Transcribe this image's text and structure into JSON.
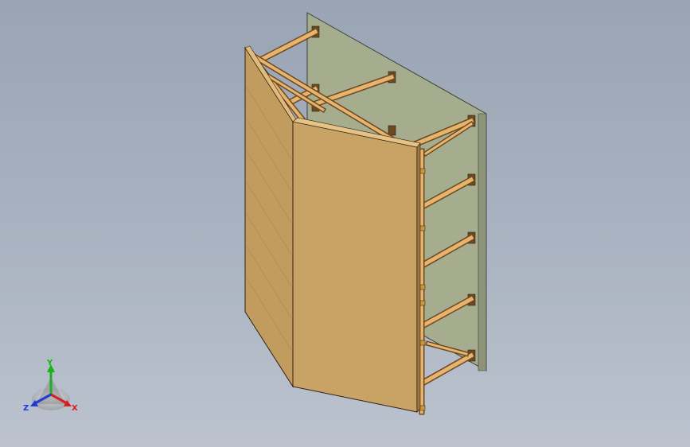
{
  "viewport": {
    "background_top": "#99a4b4",
    "background_bottom": "#bcc3cf"
  },
  "model": {
    "panel_front_color": "#c9a366",
    "panel_side_color": "#c29c5e",
    "backplate_color": "#a6ad8f",
    "frame_color": "#e8b36c",
    "frame_dark_color": "#6b4a22"
  },
  "triad": {
    "x_label": "X",
    "y_label": "Y",
    "z_label": "Z",
    "x_color": "#d81e1e",
    "y_color": "#19b219",
    "z_color": "#1e3cd8"
  }
}
